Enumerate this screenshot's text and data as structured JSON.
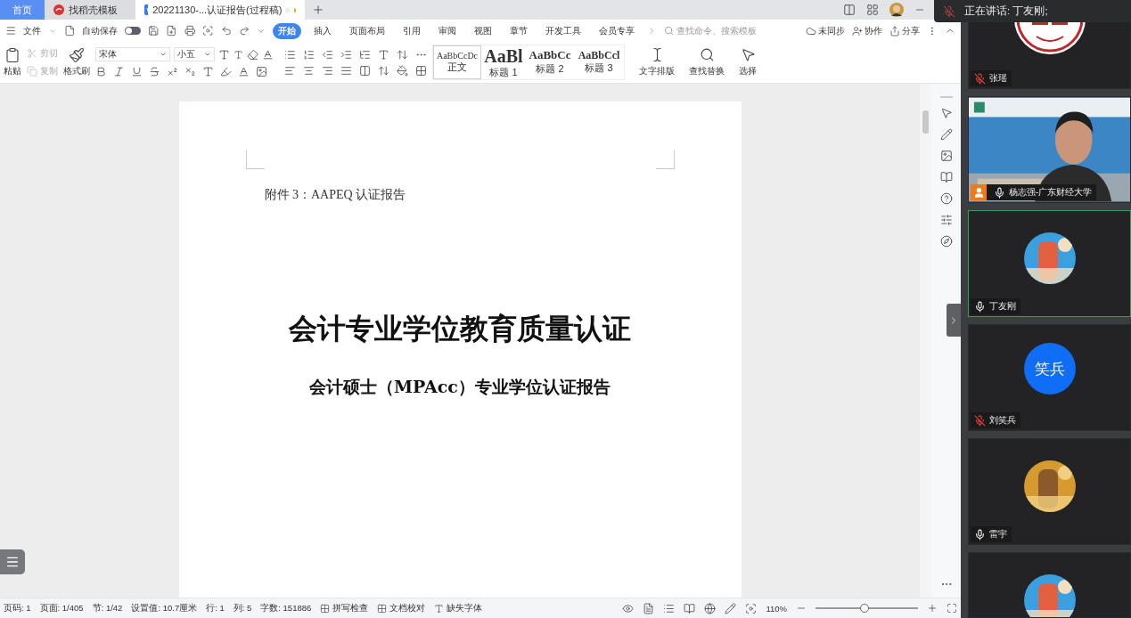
{
  "tabs": [
    {
      "label": "首页",
      "kind": "home",
      "selected": false
    },
    {
      "label": "找稻壳模板",
      "kind": "template",
      "selected": false
    },
    {
      "label": "20221130-...认证报告(过程稿)",
      "kind": "document",
      "selected": true,
      "unsaved": true
    }
  ],
  "menu": {
    "file": "文件",
    "autosave": {
      "label": "自动保存",
      "on": false
    },
    "tabs": [
      {
        "label": "开始",
        "selected": true
      },
      {
        "label": "插入",
        "selected": false
      },
      {
        "label": "页面布局",
        "selected": false
      },
      {
        "label": "引用",
        "selected": false
      },
      {
        "label": "审阅",
        "selected": false
      },
      {
        "label": "视图",
        "selected": false
      },
      {
        "label": "章节",
        "selected": false
      },
      {
        "label": "开发工具",
        "selected": false
      },
      {
        "label": "会员专享",
        "selected": false
      }
    ],
    "search": {
      "placeholder": "查找命令、搜索模板"
    },
    "actions": [
      "未同步",
      "协作",
      "分享"
    ]
  },
  "ribbon": {
    "paste": "粘贴",
    "cut": {
      "label": "剪切",
      "disabled": true
    },
    "copy": {
      "label": "复制",
      "disabled": true
    },
    "format_painter": "格式刷",
    "font": "宋体",
    "size": "小五",
    "styles": [
      {
        "preview": "AaBbCcDc",
        "label": "正文",
        "selected": true
      },
      {
        "preview": "AaBl",
        "label": "标题 1",
        "selected": false
      },
      {
        "preview": "AaBbCc",
        "label": "标题 2",
        "selected": false
      },
      {
        "preview": "AaBbCcl",
        "label": "标题 3",
        "selected": false
      }
    ],
    "tools": [
      "文字排版",
      "查找替换",
      "选择"
    ]
  },
  "document": {
    "attachment": "附件 3：AAPEQ 认证报告",
    "title": "会计专业学位教育质量认证",
    "subtitle": "会计硕士（MPAcc）专业学位认证报告"
  },
  "status_bar": {
    "items": [
      "页码: 1",
      "页面: 1/405",
      "节: 1/42",
      "设置值: 10.7厘米",
      "行: 1",
      "列: 5",
      "字数: 151886"
    ],
    "checks": [
      "拼写检查",
      "文档校对",
      "缺失字体"
    ],
    "zoom": "110%",
    "level": 0.48
  },
  "meeting": {
    "speaking": "正在讲话: 丁友刚;",
    "participants": [
      {
        "name": "张瑶",
        "muted": true,
        "active": false,
        "host": false,
        "avatar": {
          "kind": "logo"
        }
      },
      {
        "name": "杨志强-广东财经大学",
        "muted": false,
        "active": false,
        "host": true,
        "avatar": {
          "kind": "video"
        }
      },
      {
        "name": "丁友刚",
        "muted": false,
        "active": true,
        "host": false
      },
      {
        "name": "刘笑兵",
        "muted": true,
        "active": false,
        "host": false,
        "avatar": {
          "kind": "initials",
          "text": "笑兵"
        }
      },
      {
        "name": "雷宇",
        "muted": false,
        "active": false,
        "host": false
      },
      {
        "active": false
      }
    ]
  }
}
